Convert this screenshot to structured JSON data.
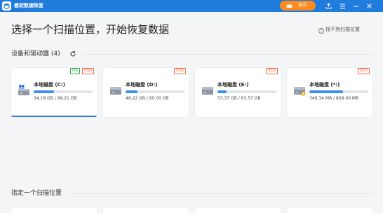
{
  "window": {
    "app_title": "傲软数据恢复",
    "upgrade_label": "激活",
    "colors": {
      "titlebar": "#1f7bdc",
      "accent": "#ff8a1f",
      "progress": "#3b8ef0"
    }
  },
  "header": {
    "title": "选择一个扫描位置，开始恢复数据",
    "help_link": "找不到扫描位置"
  },
  "drives_section": {
    "title": "设备和驱动器 (4)",
    "drives": [
      {
        "name": "本地磁盘 (C:)",
        "size": "34.18 GB / 99.21 GB",
        "badges": [
          "OS",
          "SSD"
        ],
        "usage": 0.34,
        "icon": "windows-drive-icon",
        "selected": true
      },
      {
        "name": "本地磁盘 (D:)",
        "size": "48.22 GB / 60.00 GB",
        "badges": [
          "SSD"
        ],
        "usage": 0.2,
        "icon": "hard-drive-icon",
        "selected": false
      },
      {
        "name": "本地磁盘 (E:)",
        "size": "53.37 GB / 63.57 GB",
        "badges": [
          "SSD"
        ],
        "usage": 0.16,
        "icon": "hard-drive-icon",
        "selected": false
      },
      {
        "name": "本地磁盘 (*:)",
        "size": "349.34 MB / 809.00 MB",
        "badges": [
          "SSD"
        ],
        "usage": 0.57,
        "icon": "hard-drive-warning-icon",
        "selected": false
      }
    ]
  },
  "locations_section": {
    "title": "指定一个扫描位置"
  }
}
